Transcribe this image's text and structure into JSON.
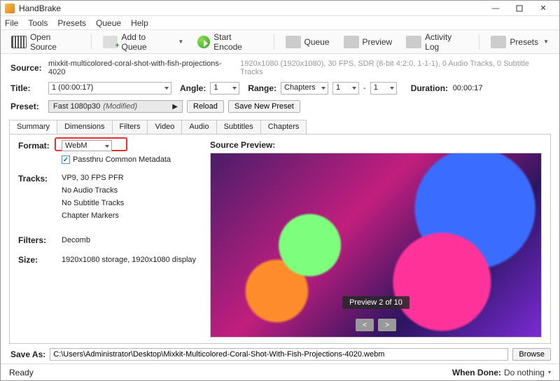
{
  "window": {
    "title": "HandBrake"
  },
  "menu": [
    "File",
    "Tools",
    "Presets",
    "Queue",
    "Help"
  ],
  "toolbar": {
    "open": "Open Source",
    "add_queue": "Add to Queue",
    "start": "Start Encode",
    "queue": "Queue",
    "preview": "Preview",
    "activity": "Activity Log",
    "presets": "Presets"
  },
  "source": {
    "label": "Source:",
    "name": "mixkit-multicolored-coral-shot-with-fish-projections-4020",
    "info": "1920x1080 (1920x1080), 30 FPS, SDR (8-bit 4:2:0, 1-1-1), 0 Audio Tracks, 0 Subtitle Tracks"
  },
  "title": {
    "label": "Title:",
    "value": "1  (00:00:17)",
    "angle_label": "Angle:",
    "angle": "1",
    "range_label": "Range:",
    "range_type": "Chapters",
    "range_from": "1",
    "range_sep": "-",
    "range_to": "1",
    "duration_label": "Duration:",
    "duration": "00:00:17"
  },
  "preset": {
    "label": "Preset:",
    "name": "Fast 1080p30",
    "modified": "(Modified)",
    "reload": "Reload",
    "save_new": "Save New Preset"
  },
  "tabs": [
    "Summary",
    "Dimensions",
    "Filters",
    "Video",
    "Audio",
    "Subtitles",
    "Chapters"
  ],
  "summary": {
    "format_label": "Format:",
    "format": "WebM",
    "passthru": "Passthru Common Metadata",
    "tracks_label": "Tracks:",
    "tracks": [
      "VP9, 30 FPS PFR",
      "No Audio Tracks",
      "No Subtitle Tracks",
      "Chapter Markers"
    ],
    "filters_label": "Filters:",
    "filters": "Decomb",
    "size_label": "Size:",
    "size": "1920x1080 storage, 1920x1080 display"
  },
  "preview": {
    "label": "Source Preview:",
    "badge": "Preview 2 of 10",
    "prev": "<",
    "next": ">"
  },
  "saveas": {
    "label": "Save As:",
    "path": "C:\\Users\\Administrator\\Desktop\\Mixkit-Multicolored-Coral-Shot-With-Fish-Projections-4020.webm",
    "browse": "Browse"
  },
  "status": {
    "ready": "Ready",
    "whendone_label": "When Done:",
    "whendone": "Do nothing"
  }
}
